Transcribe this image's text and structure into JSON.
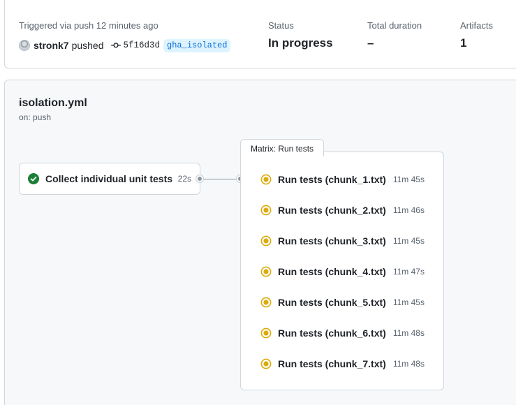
{
  "summary": {
    "trigger_text": "Triggered via push 12 minutes ago",
    "actor": "stronk7",
    "action": "pushed",
    "commit_sha": "5f16d3d",
    "branch": "gha_isolated",
    "status_label": "Status",
    "status_value": "In progress",
    "duration_label": "Total duration",
    "duration_value": "–",
    "artifacts_label": "Artifacts",
    "artifacts_value": "1"
  },
  "workflow": {
    "name": "isolation.yml",
    "trigger": "on: push",
    "job": {
      "name": "Collect individual unit tests",
      "duration": "22s",
      "status": "success"
    },
    "matrix": {
      "title": "Matrix: Run tests",
      "runs": [
        {
          "name": "Run tests (chunk_1.txt)",
          "duration": "11m 45s",
          "status": "in_progress"
        },
        {
          "name": "Run tests (chunk_2.txt)",
          "duration": "11m 46s",
          "status": "in_progress"
        },
        {
          "name": "Run tests (chunk_3.txt)",
          "duration": "11m 45s",
          "status": "in_progress"
        },
        {
          "name": "Run tests (chunk_4.txt)",
          "duration": "11m 47s",
          "status": "in_progress"
        },
        {
          "name": "Run tests (chunk_5.txt)",
          "duration": "11m 45s",
          "status": "in_progress"
        },
        {
          "name": "Run tests (chunk_6.txt)",
          "duration": "11m 48s",
          "status": "in_progress"
        },
        {
          "name": "Run tests (chunk_7.txt)",
          "duration": "11m 48s",
          "status": "in_progress"
        }
      ]
    }
  },
  "colors": {
    "success": "#1a7f37",
    "in_progress": "#dbab0a",
    "link": "#0969da",
    "muted": "#59636e"
  },
  "icons": {
    "success": "check-circle-fill-icon",
    "in_progress": "dot-fill-spinner-icon",
    "commit": "git-commit-icon"
  }
}
